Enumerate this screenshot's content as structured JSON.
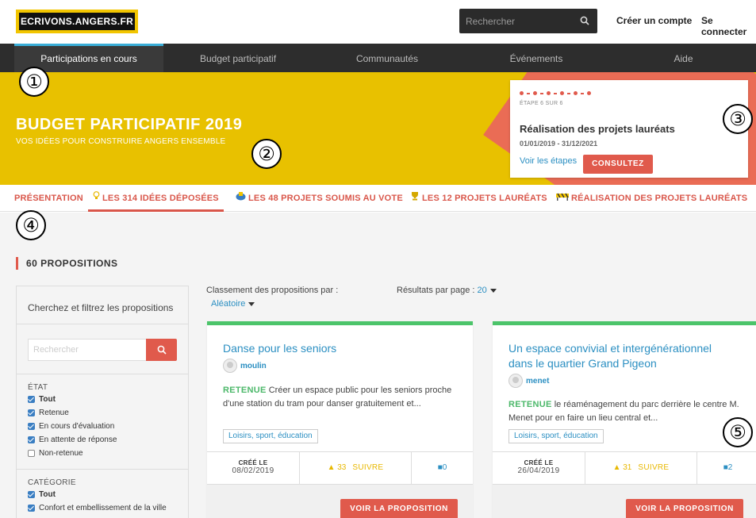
{
  "header": {
    "logo_text": "ECRIVONS.ANGERS.FR",
    "search_placeholder": "Rechercher",
    "create_account": "Créer un compte",
    "login": "Se connecter"
  },
  "nav": {
    "items": [
      {
        "label": "Participations en cours"
      },
      {
        "label": "Budget participatif"
      },
      {
        "label": "Communautés"
      },
      {
        "label": "Événements"
      },
      {
        "label": "Aide"
      }
    ]
  },
  "banner": {
    "title": "BUDGET PARTICIPATIF 2019",
    "subtitle": "VOS IDÉES POUR CONSTRUIRE ANGERS ENSEMBLE"
  },
  "step": {
    "counter": "ÉTAPE 6 SUR 6",
    "title": "Réalisation des projets lauréats",
    "dates": "01/01/2019 - 31/12/2021",
    "see_steps": "Voir les étapes",
    "button": "CONSULTEZ"
  },
  "annotations": [
    "①",
    "②",
    "③",
    "④",
    "⑤"
  ],
  "tabs": [
    {
      "label": "PRÉSENTATION"
    },
    {
      "label": "LES 314 IDÉES DÉPOSÉES",
      "icon": "lightbulb-icon"
    },
    {
      "label": "LES 48 PROJETS SOUMIS AU VOTE",
      "icon": "ballot-icon"
    },
    {
      "label": "LES 12 PROJETS LAURÉATS",
      "icon": "trophy-icon"
    },
    {
      "label": "RÉALISATION DES PROJETS LAURÉATS",
      "icon": "construction-icon"
    }
  ],
  "main": {
    "count_title": "60 PROPOSITIONS"
  },
  "filter": {
    "heading": "Cherchez et filtrez les propositions",
    "search_placeholder": "Rechercher",
    "state_title": "ÉTAT",
    "state_options": [
      {
        "label": "Tout",
        "checked": true
      },
      {
        "label": "Retenue",
        "checked": true
      },
      {
        "label": "En cours d'évaluation",
        "checked": true
      },
      {
        "label": "En attente de réponse",
        "checked": true
      },
      {
        "label": "Non-retenue",
        "checked": false
      }
    ],
    "category_title": "CATÉGORIE",
    "category_options": [
      {
        "label": "Tout",
        "checked": true
      },
      {
        "label": "Confort et embellissement de la ville",
        "checked": true
      }
    ]
  },
  "sorting": {
    "label": "Classement des propositions par :",
    "value": "Aléatoire",
    "per_page_label": "Résultats par page :",
    "per_page_value": "20"
  },
  "cards": [
    {
      "title": "Danse pour les seniors",
      "author": "moulin",
      "status": "RETENUE",
      "description": "Créer un espace public pour les seniors proche d'une station du tram pour danser gratuitement et...",
      "tag": "Loisirs, sport, éducation",
      "created_label": "CRÉÉ LE",
      "created_date": "08/02/2019",
      "votes": "33",
      "follow": "SUIVRE",
      "comments": "0",
      "button": "VOIR LA PROPOSITION"
    },
    {
      "title": "Un espace convivial et intergénérationnel dans le quartier Grand Pigeon",
      "author": "menet",
      "status": "RETENUE",
      "description": "le réaménagement du parc derrière le centre M. Menet pour en faire un lieu central et...",
      "tag": "Loisirs, sport, éducation",
      "created_label": "CRÉÉ LE",
      "created_date": "26/04/2019",
      "votes": "31",
      "follow": "SUIVRE",
      "comments": "2",
      "button": "VOIR LA PROPOSITION"
    }
  ],
  "colors": {
    "brand_yellow": "#e8c100",
    "accent_red": "#e05a4c",
    "link_blue": "#2b8fc2",
    "success_green": "#4cc46a",
    "nav_dark": "#2d2d2d"
  }
}
